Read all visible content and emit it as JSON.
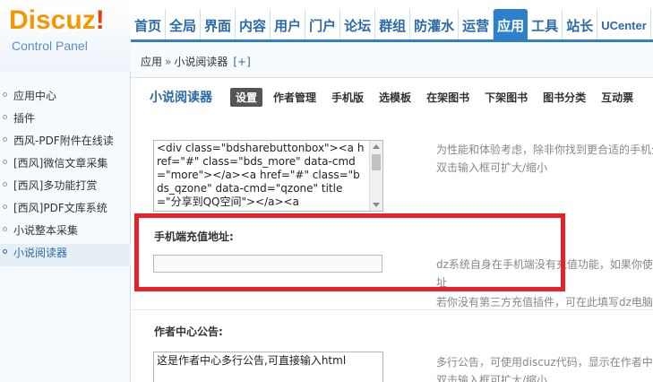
{
  "logo": {
    "main": "Discuz",
    "bang": "!",
    "sub": "Control Panel"
  },
  "topnav": [
    {
      "label": "首页"
    },
    {
      "label": "全局"
    },
    {
      "label": "界面"
    },
    {
      "label": "内容"
    },
    {
      "label": "用户"
    },
    {
      "label": "门户"
    },
    {
      "label": "论坛"
    },
    {
      "label": "群组"
    },
    {
      "label": "防灌水"
    },
    {
      "label": "运营"
    },
    {
      "label": "应用"
    },
    {
      "label": "工具"
    },
    {
      "label": "站长"
    },
    {
      "label": "UCenter"
    }
  ],
  "breadcrumb": {
    "root": "应用",
    "sep": "»",
    "current": "小说阅读器",
    "plus": "[+]"
  },
  "sidebar": {
    "items": [
      {
        "label": "应用中心"
      },
      {
        "label": "插件"
      },
      {
        "label": "西风-PDF附件在线读"
      },
      {
        "label": "[西风]微信文章采集"
      },
      {
        "label": "[西风]多功能打赏"
      },
      {
        "label": "[西风]PDF文库系统"
      },
      {
        "label": "小说整本采集"
      },
      {
        "label": "小说阅读器"
      }
    ]
  },
  "subtabs": {
    "plugin_name": "小说阅读器",
    "tabs": [
      {
        "label": "设置"
      },
      {
        "label": "作者管理"
      },
      {
        "label": "手机版"
      },
      {
        "label": "选模板"
      },
      {
        "label": "在架图书"
      },
      {
        "label": "下架图书"
      },
      {
        "label": "图书分类"
      },
      {
        "label": "互动票"
      }
    ]
  },
  "share_code": {
    "value": "<div class=\"bdsharebuttonbox\"><a href=\"#\" class=\"bds_more\" data-cmd=\"more\"></a><a href=\"#\" class=\"bds_qzone\" data-cmd=\"qzone\" title=\"分享到QQ空间\"></a><a",
    "tip1": "为性能和体验考虑，除非你找到更合适的手机分",
    "tip2": "双击输入框可扩大/缩小"
  },
  "recharge": {
    "label": "手机端充值地址:",
    "value": "",
    "tip1": "dz系统自身在手机端没有充值功能，如果你使",
    "tip2": "址",
    "tip3": "若你没有第三方充值插件，可在此填写dz电脑端"
  },
  "author_notice": {
    "label": "作者中心公告:",
    "value": "这是作者中心多行公告,可直接输入html",
    "tip1": "多行公告，可使用discuz代码，显示在作者中心",
    "tip2": "双击输入框可扩大/缩小"
  }
}
